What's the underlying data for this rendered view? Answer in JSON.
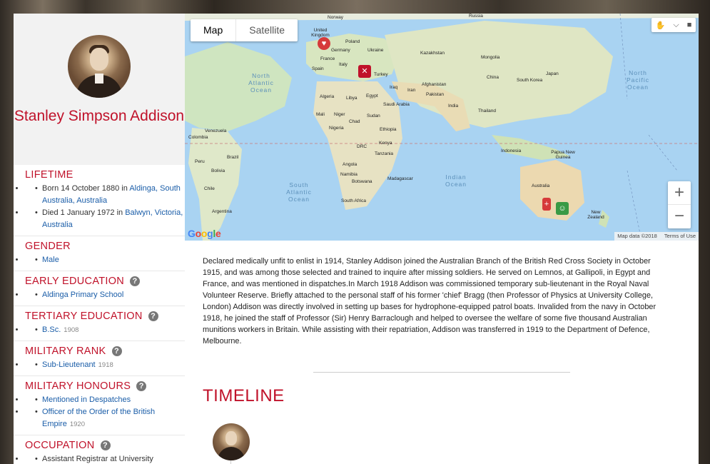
{
  "person": {
    "name": "Stanley Simpson Addison"
  },
  "sections": {
    "lifetime": {
      "title": "LIFETIME",
      "born_prefix": "Born 14 October 1880 in ",
      "born_place": "Aldinga, South Australia, Australia",
      "died_prefix": "Died 1 January 1972 in ",
      "died_place": "Balwyn, Victoria, Australia"
    },
    "gender": {
      "title": "GENDER",
      "value": "Male"
    },
    "early_education": {
      "title": "EARLY EDUCATION",
      "value": "Aldinga Primary School"
    },
    "tertiary_education": {
      "title": "TERTIARY EDUCATION",
      "value": "B.Sc.",
      "year": "1908"
    },
    "military_rank": {
      "title": "MILITARY RANK",
      "value": "Sub-Lieutenant",
      "year": "1918"
    },
    "military_honours": {
      "title": "MILITARY HONOURS",
      "items": [
        {
          "label": "Mentioned in Despatches",
          "year": ""
        },
        {
          "label": "Officer of the Order of the British Empire",
          "year": "1920"
        }
      ]
    },
    "occupation": {
      "title": "OCCUPATION",
      "value": "Assistant Registrar at University"
    }
  },
  "map": {
    "tabs": [
      "Map",
      "Satellite"
    ],
    "active_tab": "Map",
    "zoom_in": "+",
    "zoom_out": "−",
    "logo": "Google",
    "attribution": "Map data ©2018",
    "terms": "Terms of Use",
    "oceans": {
      "north_atlantic": "North Atlantic Ocean",
      "south_atlantic": "South Atlantic Ocean",
      "indian": "Indian Ocean",
      "north_pacific": "North Pacific Ocean"
    },
    "places": [
      "Norway",
      "Russia",
      "United Kingdom",
      "Poland",
      "Germany",
      "Ukraine",
      "France",
      "Kazakhstan",
      "Mongolia",
      "Spain",
      "Italy",
      "Turkey",
      "China",
      "Japan",
      "South Korea",
      "Afghanistan",
      "Iran",
      "Iraq",
      "Pakistan",
      "Algeria",
      "Libya",
      "Egypt",
      "Saudi Arabia",
      "India",
      "Mali",
      "Niger",
      "Sudan",
      "Chad",
      "Thailand",
      "Nigeria",
      "Ethiopia",
      "Venezuela",
      "Colombia",
      "Kenya",
      "DRC",
      "Tanzania",
      "Indonesia",
      "Papua New Guinea",
      "Brazil",
      "Peru",
      "Angola",
      "Bolivia",
      "Madagascar",
      "Namibia",
      "Botswana",
      "Chile",
      "South Africa",
      "Australia",
      "Argentina",
      "New Zealand"
    ],
    "marker_colors": {
      "heart": "#d63a3a",
      "cross": "#c0122a",
      "person": "#3a9a45"
    }
  },
  "bio": "Declared medically unfit to enlist in 1914, Stanley Addison joined the Australian Branch of the British Red Cross Society in October 1915, and was among those selected and trained to inquire after missing soldiers. He served on Lemnos, at Gallipoli, in Egypt and France, and was mentioned in dispatches.In March 1918 Addison was commissioned temporary sub-lieutenant in the Royal Naval Volunteer Reserve. Briefly attached to the personal staff of his former 'chief' Bragg (then Professor of Physics at University College, London) Addison was directly involved in setting up bases for hydrophone-equipped patrol boats. Invalided from the navy in October 1918, he joined the staff of Professor (Sir) Henry Barraclough and helped to oversee the welfare of some five thousand Australian munitions workers in Britain. While assisting with their repatriation, Addison was transferred in 1919 to the Department of Defence, Melbourne.",
  "timeline": {
    "title": "TIMELINE"
  },
  "help_glyph": "?"
}
